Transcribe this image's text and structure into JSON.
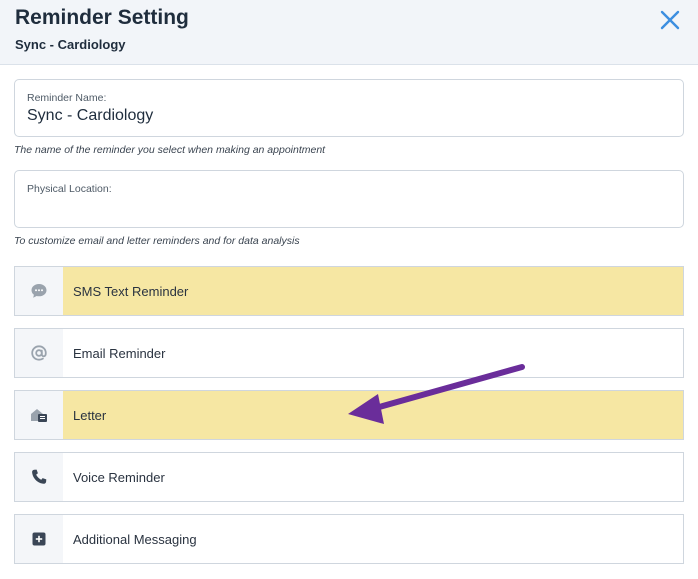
{
  "header": {
    "title": "Reminder Setting",
    "subtitle": "Sync - Cardiology"
  },
  "close_icon": "close-icon",
  "reminder_name": {
    "label": "Reminder Name:",
    "value": "Sync - Cardiology",
    "hint": "The name of the reminder you select when making an appointment"
  },
  "physical_location": {
    "label": "Physical Location:",
    "value": "",
    "hint": "To customize email and letter reminders and for data analysis"
  },
  "options": [
    {
      "label": "SMS Text Reminder",
      "icon": "chat-bubble-icon",
      "highlighted": true
    },
    {
      "label": "Email Reminder",
      "icon": "at-sign-icon",
      "highlighted": false
    },
    {
      "label": "Letter",
      "icon": "mailbox-icon",
      "highlighted": true
    },
    {
      "label": "Voice Reminder",
      "icon": "phone-icon",
      "highlighted": false
    },
    {
      "label": "Additional Messaging",
      "icon": "plus-square-icon",
      "highlighted": false
    }
  ],
  "colors": {
    "highlight": "#f6e7a3",
    "accent_blue": "#3d8fe0",
    "arrow": "#6a2d9a",
    "icon_gray": "#9aa3ad",
    "header_bg": "#f2f5f9"
  }
}
